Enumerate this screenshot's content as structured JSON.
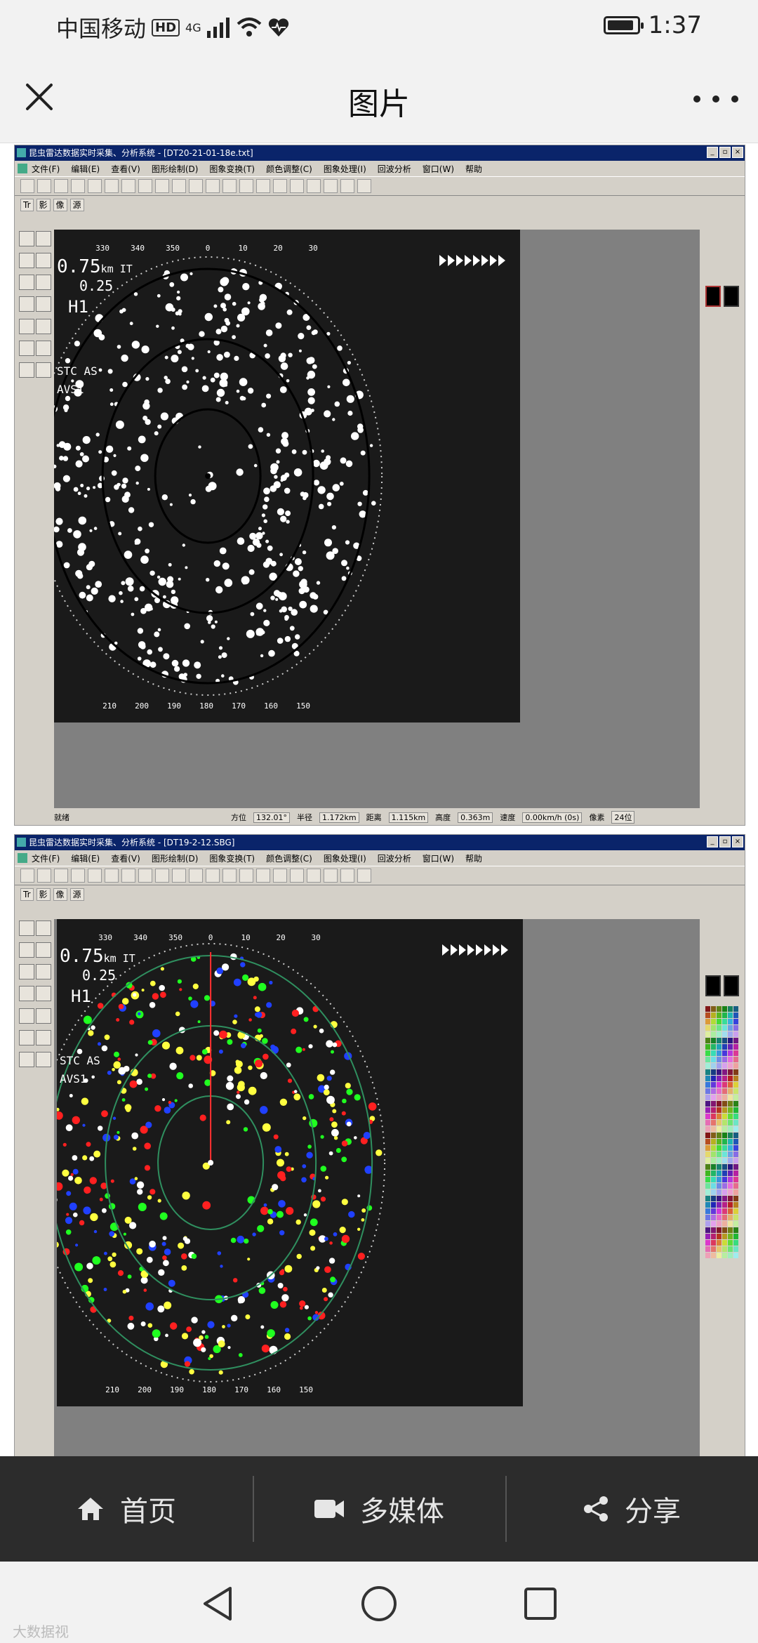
{
  "status_bar": {
    "carrier": "中国移动",
    "hd": "HD",
    "network": "4G",
    "time": "1:37"
  },
  "header": {
    "title": "图片"
  },
  "screenshots": [
    {
      "window_title": "昆虫雷达数据实时采集、分析系统 - [DT20-21-01-18e.txt]",
      "menus": [
        "文件(F)",
        "编辑(E)",
        "查看(V)",
        "图形绘制(D)",
        "图象变换(T)",
        "颜色调整(C)",
        "图象处理(I)",
        "回波分析",
        "窗口(W)",
        "帮助"
      ],
      "tool_tabs": [
        "Tr",
        "影",
        "像",
        "源"
      ],
      "readout": {
        "range": "0.75",
        "range_unit": "km IT",
        "ring": "0.25",
        "mode": "H1",
        "stc": "STC AS",
        "avs": "AVS1"
      },
      "bearings_top": [
        "330",
        "340",
        "350",
        "0",
        "10",
        "20",
        "30"
      ],
      "bearings_bottom": [
        "210",
        "200",
        "190",
        "180",
        "170",
        "160",
        "150"
      ],
      "status": {
        "left": "就绪",
        "azimuth_label": "方位",
        "azimuth": "132.01°",
        "radius_label": "半径",
        "radius": "1.172km",
        "distance_label": "距离",
        "distance": "1.115km",
        "height_label": "高度",
        "height": "0.363m",
        "speed_label": "速度",
        "speed": "0.00km/h (0s)",
        "pixel_label": "像素",
        "pixel": "24位"
      }
    },
    {
      "window_title": "昆虫雷达数据实时采集、分析系统 - [DT19-2-12.SBG]",
      "menus": [
        "文件(F)",
        "编辑(E)",
        "查看(V)",
        "图形绘制(D)",
        "图象变换(T)",
        "颜色调整(C)",
        "图象处理(I)",
        "回波分析",
        "窗口(W)",
        "帮助"
      ],
      "tool_tabs": [
        "Tr",
        "影",
        "像",
        "源"
      ],
      "readout": {
        "range": "0.75",
        "range_unit": "km IT",
        "ring": "0.25",
        "mode": "H1",
        "stc": "STC AS",
        "avs": "AVS1"
      },
      "bearings_top": [
        "330",
        "340",
        "350",
        "0",
        "10",
        "20",
        "30"
      ],
      "bearings_bottom": [
        "210",
        "200",
        "190",
        "180",
        "170",
        "160",
        "150"
      ]
    }
  ],
  "tabbar": {
    "home": "首页",
    "media": "多媒体",
    "share": "分享"
  },
  "watermark": "大数据视"
}
